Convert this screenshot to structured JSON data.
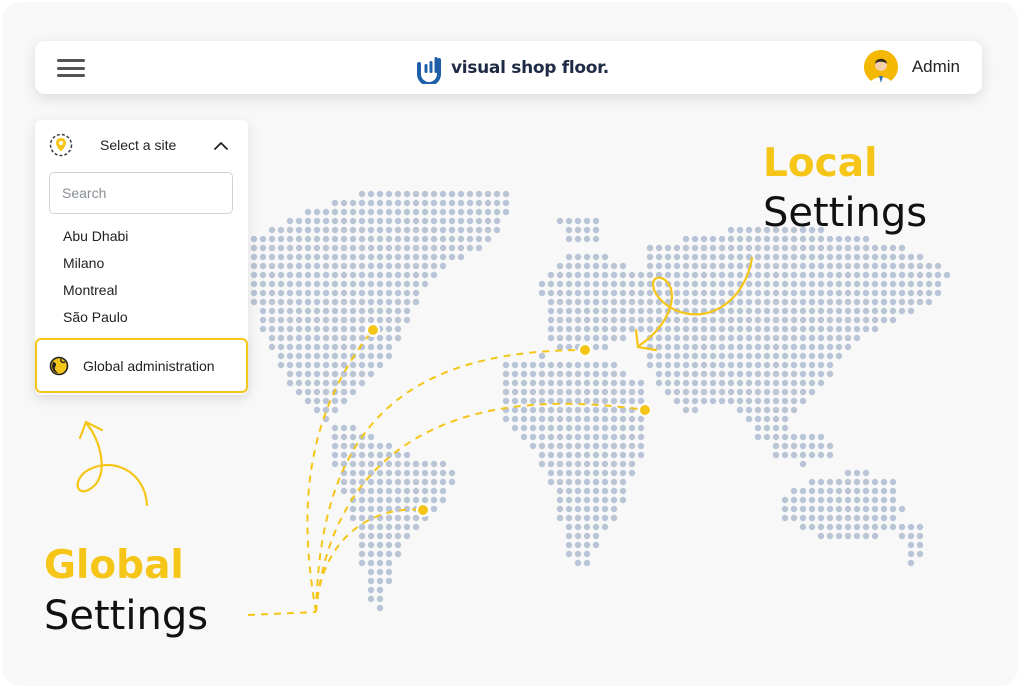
{
  "header": {
    "brand": "visual shop floor.",
    "user_name": "Admin"
  },
  "site_selector": {
    "title": "Select a site",
    "search_placeholder": "Search",
    "sites": [
      "Abu Dhabi",
      "Milano",
      "Montreal",
      "São Paulo"
    ],
    "global_admin_label": "Global administration"
  },
  "callouts": {
    "local_accent": "Local",
    "local_main": "Settings",
    "global_accent": "Global",
    "global_main": "Settings"
  },
  "colors": {
    "accent": "#f5c518",
    "dot": "#b9c4d6",
    "text": "#111111",
    "brand_blue": "#1f5fa8"
  },
  "icons": {
    "menu": "hamburger-icon",
    "pin": "map-pin-icon",
    "chevron": "chevron-up-icon",
    "globe": "globe-icon"
  }
}
